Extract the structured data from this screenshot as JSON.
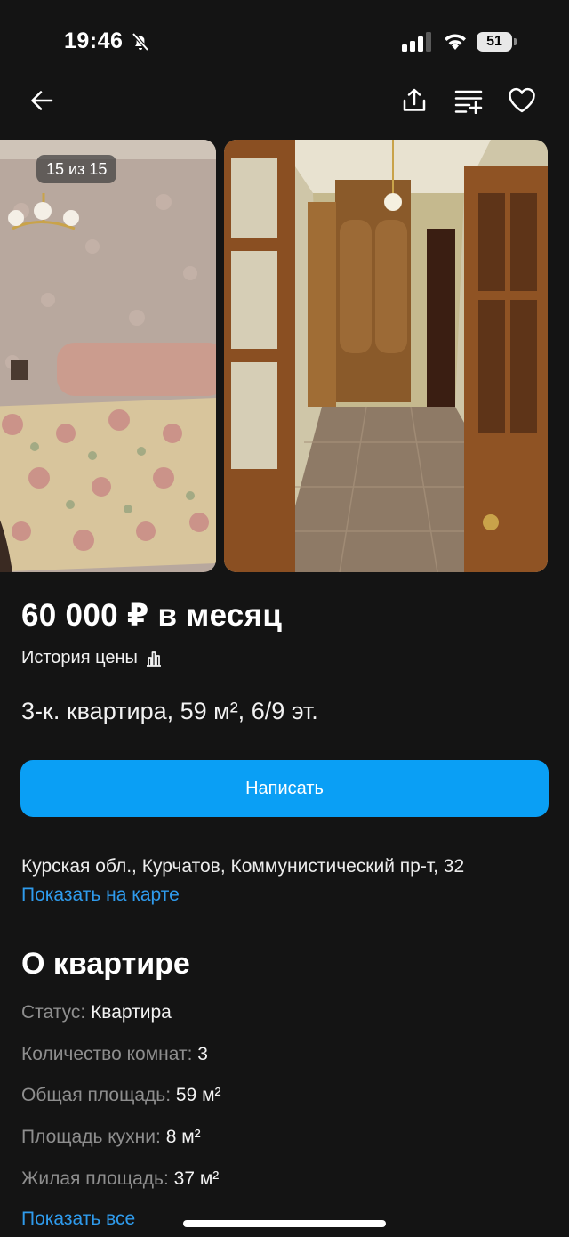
{
  "status_bar": {
    "time": "19:46",
    "battery": "51",
    "icons": [
      "bell-off-icon",
      "cellular-signal-icon",
      "wifi-icon",
      "battery-icon"
    ]
  },
  "nav": {
    "icons": [
      "arrow-left-icon",
      "share-icon",
      "compare-icon",
      "heart-icon"
    ]
  },
  "gallery": {
    "counter": "15 из 15"
  },
  "listing": {
    "price": "60 000 ₽ в месяц",
    "price_history_label": "История цены",
    "title": "3-к. квартира, 59 м², 6/9 эт.",
    "write_button_label": "Написать",
    "address": "Курская обл., Курчатов, Коммунистический пр-т, 32",
    "show_on_map_label": "Показать на карте"
  },
  "about": {
    "title": "О квартире",
    "params": [
      {
        "key": "Статус:",
        "value": "Квартира"
      },
      {
        "key": "Количество комнат:",
        "value": "3"
      },
      {
        "key": "Общая площадь:",
        "value": "59 м²"
      },
      {
        "key": "Площадь кухни:",
        "value": "8 м²"
      },
      {
        "key": "Жилая площадь:",
        "value": "37 м²"
      }
    ],
    "show_all_label": "Показать все"
  },
  "colors": {
    "background": "#141414",
    "accent_button": "#0a9ff5",
    "link": "#2f9bec",
    "muted_text": "#8e8e8e"
  }
}
